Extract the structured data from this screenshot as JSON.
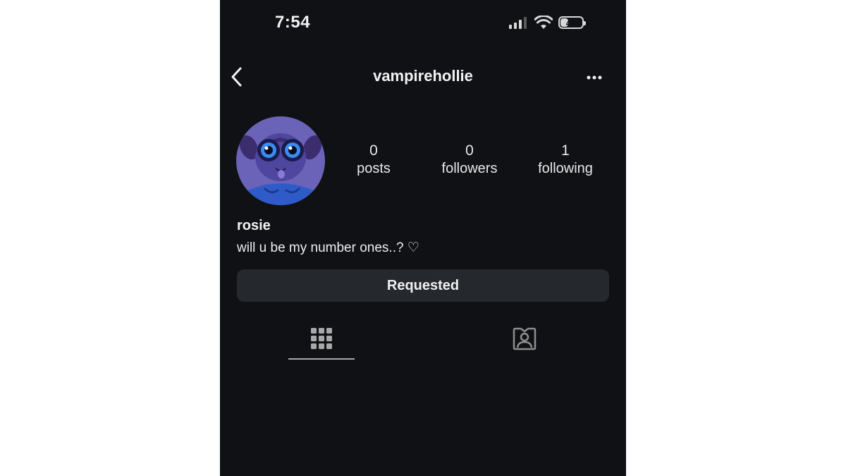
{
  "status_bar": {
    "time": "7:54",
    "battery": "41",
    "battery_level": 0.41
  },
  "header": {
    "username": "vampirehollie",
    "back_icon": "chevron-left-icon",
    "more_icon": "more-horizontal-icon"
  },
  "profile": {
    "avatar": "avatar-cartoon-girl",
    "stats": [
      {
        "value": "0",
        "label": "posts"
      },
      {
        "value": "0",
        "label": "followers"
      },
      {
        "value": "1",
        "label": "following"
      }
    ],
    "display_name": "rosie",
    "bio": "will u be my number ones..? ♡"
  },
  "actions": {
    "follow_status_label": "Requested"
  },
  "tabs": [
    {
      "icon": "grid-icon",
      "active": true
    },
    {
      "icon": "tagged-person-icon",
      "active": false
    }
  ],
  "colors": {
    "background": "#0f1114",
    "button": "#25282d",
    "text": "#f2f2f2"
  }
}
